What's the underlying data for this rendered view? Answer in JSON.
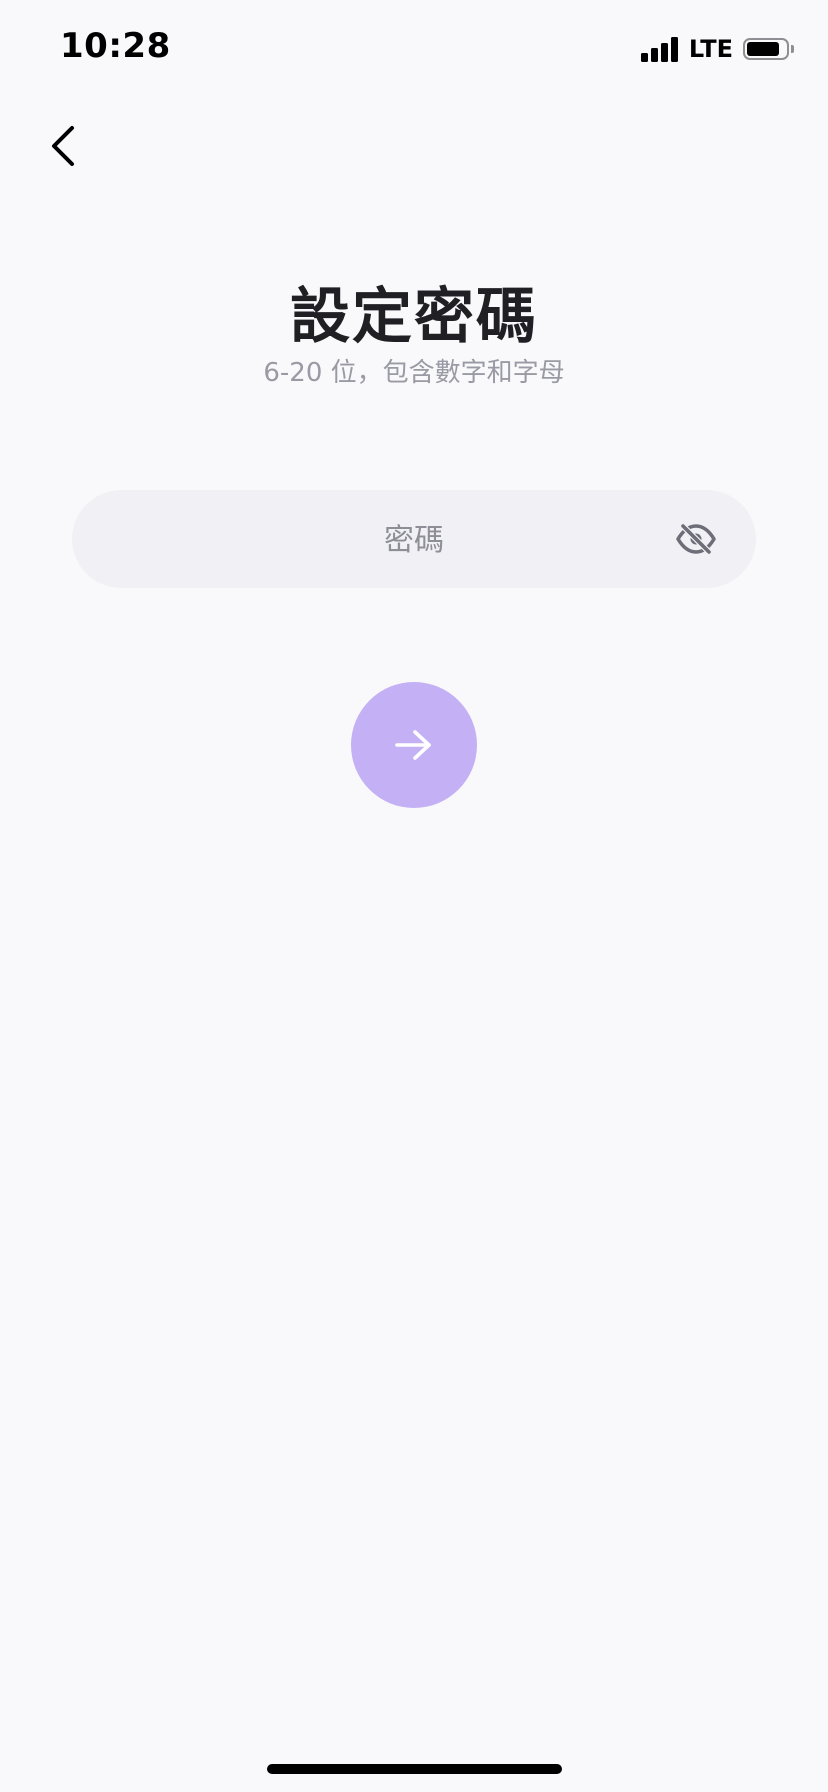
{
  "status_bar": {
    "time": "10:28",
    "network": "LTE",
    "signal_icon": "cellular-signal-icon",
    "battery_icon": "battery-icon",
    "battery_level": 0.85
  },
  "nav": {
    "back_icon": "chevron-left-icon"
  },
  "header": {
    "title": "設定密碼",
    "subtitle": "6-20 位，包含數字和字母"
  },
  "password_field": {
    "placeholder": "密碼",
    "value": "",
    "visibility_icon": "eye-off-icon"
  },
  "next_button": {
    "icon": "arrow-right-icon",
    "enabled": false
  },
  "colors": {
    "background": "#f9f9fb",
    "field_background": "#f1f1f5",
    "title_text": "#1f1f24",
    "subtitle_text": "#9a9aa4",
    "icon_gray": "#6e6e78",
    "accent_disabled": "#c4b0f5"
  }
}
